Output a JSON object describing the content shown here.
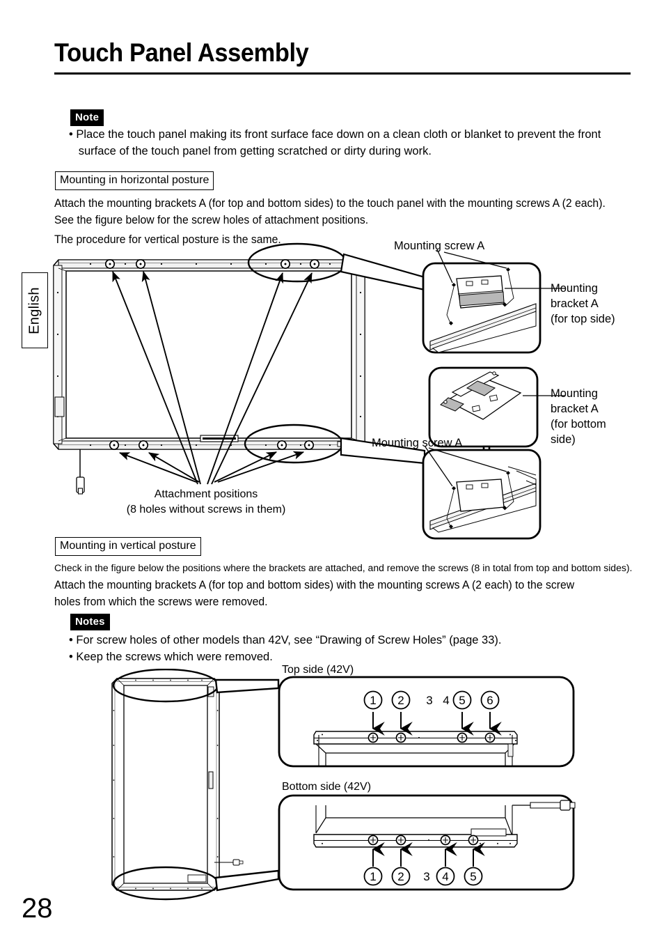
{
  "page": {
    "title": "Touch Panel Assembly",
    "number": "28",
    "side_tab": "English"
  },
  "note_top": {
    "tag": "Note",
    "bullets": [
      "• Place the touch panel making its front surface face down on a clean cloth or blanket to prevent the front",
      "   surface of the touch panel from getting scratched or dirty during work."
    ]
  },
  "horizontal_section": {
    "heading": "Mounting in horizontal posture",
    "paragraph_lines": [
      "Attach the mounting brackets A (for top and bottom sides) to the touch panel with the mounting screws A (2 each).",
      "See the figure below for the screw holes of attachment positions."
    ],
    "paragraph2": "The procedure for vertical posture is the same."
  },
  "horizontal_figure": {
    "screw_label_top": "Mounting screw A",
    "screw_label_bottom": "Mounting screw A",
    "bracket_top_label": "Mounting\nbracket A\n(for top side)",
    "bracket_bottom_label": "Mounting\nbracket A\n(for bottom\nside)",
    "attachment_caption_line1": "Attachment positions",
    "attachment_caption_line2": "(8 holes without screws in them)"
  },
  "vertical_section": {
    "heading": "Mounting in vertical posture",
    "line1": "Check in the figure below the positions where the brackets are attached, and remove the screws (8 in total from top and bottom sides).",
    "line2": "Attach the mounting brackets A (for top and bottom sides) with the mounting screws A (2 each) to the screw",
    "line3": "holes from which the screws were removed."
  },
  "notes_bottom": {
    "tag": "Notes",
    "bullets": [
      "• For screw holes of other models than 42V, see “Drawing of Screw Holes” (page 33).",
      "• Keep the screws which were removed."
    ]
  },
  "vertical_figure": {
    "top_caption": "Top side (42V)",
    "bottom_caption": "Bottom side (42V)",
    "top_markers": [
      {
        "label": "1",
        "circled": true,
        "arrow": true
      },
      {
        "label": "2",
        "circled": true,
        "arrow": true
      },
      {
        "label": "3",
        "circled": false,
        "arrow": false
      },
      {
        "label": "4",
        "circled": false,
        "arrow": false
      },
      {
        "label": "5",
        "circled": true,
        "arrow": true
      },
      {
        "label": "6",
        "circled": true,
        "arrow": true
      }
    ],
    "bottom_markers": [
      {
        "label": "1",
        "circled": true,
        "arrow": true
      },
      {
        "label": "2",
        "circled": true,
        "arrow": true
      },
      {
        "label": "3",
        "circled": false,
        "arrow": false
      },
      {
        "label": "4",
        "circled": true,
        "arrow": true
      },
      {
        "label": "5",
        "circled": true,
        "arrow": true
      }
    ]
  },
  "colors": {
    "ink": "#000000",
    "paper": "#ffffff",
    "shade": "#b8b8b8",
    "light_shade": "#d8d8d8"
  }
}
